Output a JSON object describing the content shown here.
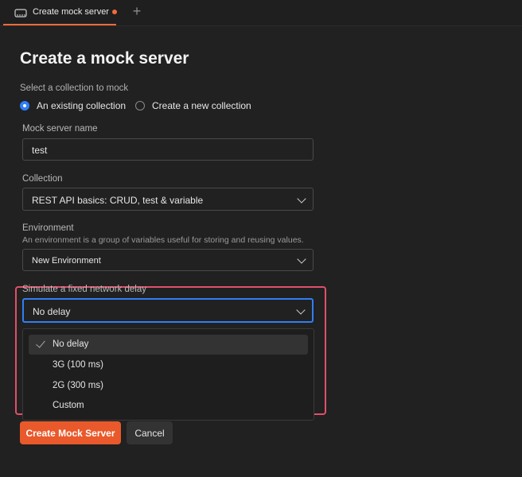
{
  "tab": {
    "title": "Create mock server",
    "icon": "mock-server-icon",
    "unsaved_color": "#f26b3a",
    "new_tab_glyph": "+"
  },
  "page": {
    "title": "Create a mock server"
  },
  "collection_source": {
    "label": "Select a collection to mock",
    "options": [
      {
        "label": "An existing collection",
        "checked": true
      },
      {
        "label": "Create a new collection",
        "checked": false
      }
    ]
  },
  "mock_name": {
    "label": "Mock server name",
    "value": "test"
  },
  "collection": {
    "label": "Collection",
    "value": "REST API basics: CRUD, test & variable"
  },
  "environment": {
    "label": "Environment",
    "help": "An environment is a group of variables useful for storing and reusing values.",
    "value": "New Environment"
  },
  "delay": {
    "label": "Simulate a fixed network delay",
    "value": "No delay",
    "options": [
      {
        "label": "No delay",
        "selected": true
      },
      {
        "label": "3G (100 ms)",
        "selected": false
      },
      {
        "label": "2G (300 ms)",
        "selected": false
      },
      {
        "label": "Custom",
        "selected": false
      }
    ]
  },
  "actions": {
    "create_label": "Create Mock Server",
    "cancel_label": "Cancel"
  },
  "colors": {
    "accent": "#e9592b",
    "focus": "#2f7ff5",
    "highlight": "#e0506a"
  }
}
